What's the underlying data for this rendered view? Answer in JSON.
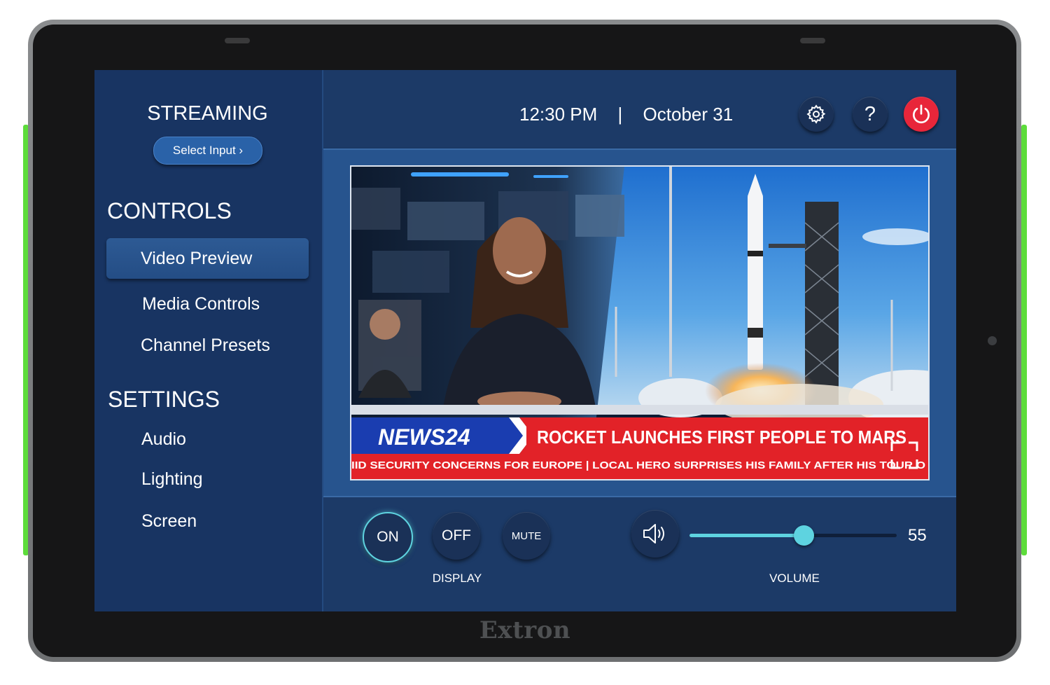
{
  "device": {
    "brand": "Extron"
  },
  "sidebar": {
    "streaming_title": "STREAMING",
    "select_input_label": "Select Input ›",
    "controls_heading": "CONTROLS",
    "controls_items": [
      {
        "label": "Video Preview",
        "active": true
      },
      {
        "label": "Media Controls",
        "active": false
      },
      {
        "label": "Channel Presets",
        "active": false
      }
    ],
    "settings_heading": "SETTINGS",
    "settings_items": [
      {
        "label": "Audio"
      },
      {
        "label": "Lighting"
      },
      {
        "label": "Screen"
      }
    ]
  },
  "header": {
    "time": "12:30 PM",
    "separator": "|",
    "date": "October 31",
    "icons": [
      "gear-icon",
      "question-icon",
      "power-icon"
    ]
  },
  "video": {
    "logo": "NEWS24",
    "headline": "ROCKET LAUNCHES FIRST PEOPLE TO MARS",
    "ticker": "IID SECURITY CONCERNS FOR EUROPE  |  LOCAL HERO SURPRISES HIS FAMILY AFTER HIS TOUR O",
    "overlay_icon": "fullscreen-icon"
  },
  "controls": {
    "display": {
      "on": "ON",
      "off": "OFF",
      "mute": "MUTE",
      "label": "DISPLAY",
      "state": "on"
    },
    "volume": {
      "icon": "speaker-icon",
      "value": 55,
      "level_fraction": 0.55,
      "label": "VOLUME"
    }
  },
  "colors": {
    "accent": "#5ed3e0",
    "power": "#e8263a",
    "panel": "#1b3864",
    "led": "#5ddc3b"
  }
}
